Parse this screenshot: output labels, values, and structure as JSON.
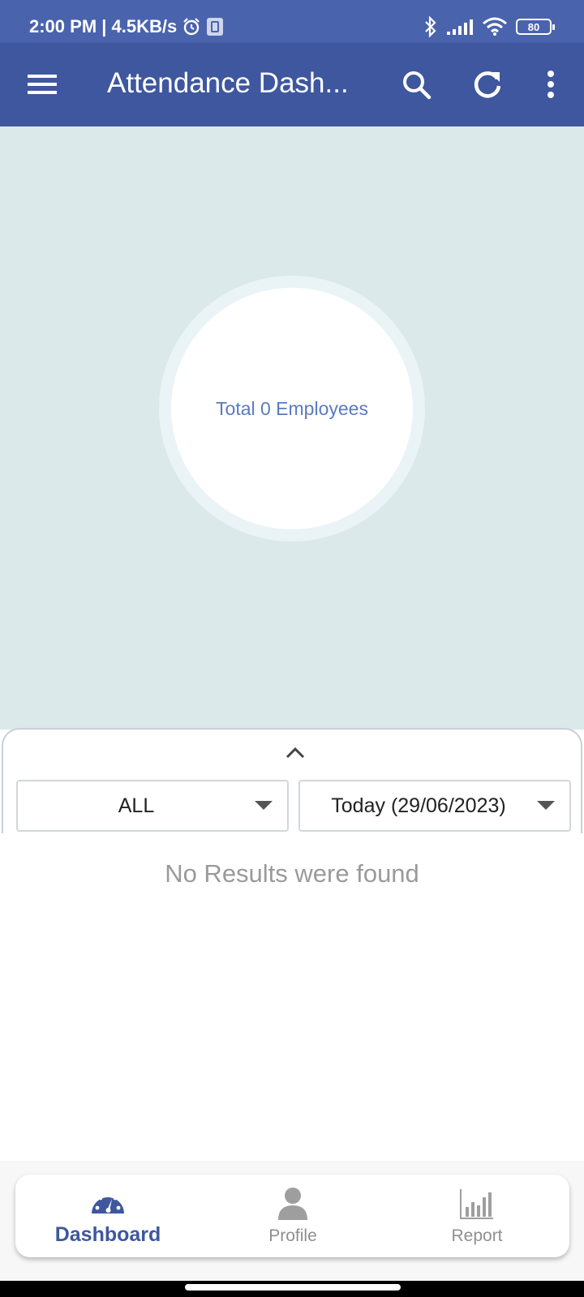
{
  "status_bar": {
    "time_speed": "2:00 PM | 4.5KB/s",
    "battery": "80"
  },
  "app_bar": {
    "title": "Attendance Dash..."
  },
  "summary": {
    "total_text": "Total 0 Employees"
  },
  "filters": {
    "status_value": "ALL",
    "date_value": "Today (29/06/2023)"
  },
  "results": {
    "empty_text": "No Results were found"
  },
  "bottom_nav": {
    "items": [
      {
        "label": "Dashboard",
        "icon": "dashboard-gauge-icon",
        "active": true
      },
      {
        "label": "Profile",
        "icon": "person-icon",
        "active": false
      },
      {
        "label": "Report",
        "icon": "bar-chart-icon",
        "active": false
      }
    ]
  },
  "colors": {
    "status_bar": "#4a63ad",
    "app_bar": "#3e579e",
    "summary_bg": "#dbe9ea",
    "accent_text": "#5a7bbf",
    "inactive_nav": "#8f8f8f"
  }
}
